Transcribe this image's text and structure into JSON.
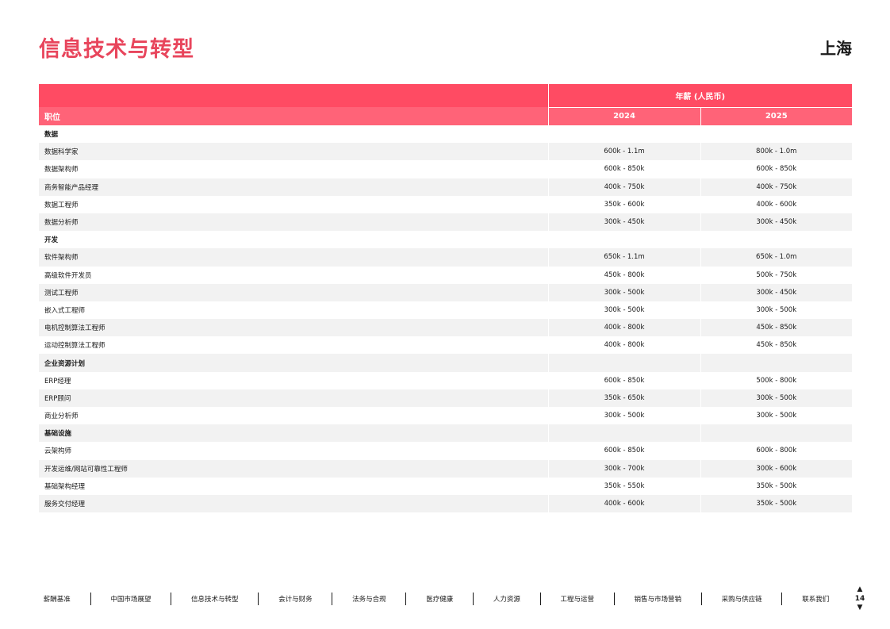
{
  "title": "信息技术与转型",
  "city": "上海",
  "table": {
    "group_header": "年薪 (人民币)",
    "position_header": "职位",
    "year1": "2024",
    "year2": "2025",
    "rows": [
      {
        "type": "cat",
        "role": "数据",
        "v2024": "",
        "v2025": ""
      },
      {
        "type": "item",
        "role": "数据科学家",
        "v2024": "600k - 1.1m",
        "v2025": "800k - 1.0m"
      },
      {
        "type": "item",
        "role": "数据架构师",
        "v2024": "600k - 850k",
        "v2025": "600k - 850k"
      },
      {
        "type": "item",
        "role": "商务智能产品经理",
        "v2024": "400k - 750k",
        "v2025": "400k - 750k"
      },
      {
        "type": "item",
        "role": "数据工程师",
        "v2024": "350k - 600k",
        "v2025": "400k - 600k"
      },
      {
        "type": "item",
        "role": "数据分析师",
        "v2024": "300k - 450k",
        "v2025": "300k - 450k"
      },
      {
        "type": "cat",
        "role": "开发",
        "v2024": "",
        "v2025": ""
      },
      {
        "type": "item",
        "role": "软件架构师",
        "v2024": "650k - 1.1m",
        "v2025": "650k - 1.0m"
      },
      {
        "type": "item",
        "role": "高级软件开发员",
        "v2024": "450k - 800k",
        "v2025": "500k - 750k"
      },
      {
        "type": "item",
        "role": "测试工程师",
        "v2024": "300k - 500k",
        "v2025": "300k - 450k"
      },
      {
        "type": "item",
        "role": "嵌入式工程师",
        "v2024": "300k - 500k",
        "v2025": "300k - 500k"
      },
      {
        "type": "item",
        "role": "电机控制算法工程师",
        "v2024": "400k - 800k",
        "v2025": "450k - 850k"
      },
      {
        "type": "item",
        "role": "运动控制算法工程师",
        "v2024": "400k - 800k",
        "v2025": "450k - 850k"
      },
      {
        "type": "cat",
        "role": "企业资源计划",
        "v2024": "",
        "v2025": ""
      },
      {
        "type": "item",
        "role": "ERP经理",
        "v2024": "600k - 850k",
        "v2025": "500k - 800k"
      },
      {
        "type": "item",
        "role": "ERP顾问",
        "v2024": "350k - 650k",
        "v2025": "300k - 500k"
      },
      {
        "type": "item",
        "role": "商业分析师",
        "v2024": "300k - 500k",
        "v2025": "300k - 500k"
      },
      {
        "type": "cat",
        "role": "基础设施",
        "v2024": "",
        "v2025": ""
      },
      {
        "type": "item",
        "role": "云架构师",
        "v2024": "600k - 850k",
        "v2025": "600k - 800k"
      },
      {
        "type": "item",
        "role": "开发运维/网站可靠性工程师",
        "v2024": "300k - 700k",
        "v2025": "300k - 600k"
      },
      {
        "type": "item",
        "role": "基础架构经理",
        "v2024": "350k - 550k",
        "v2025": "350k - 500k"
      },
      {
        "type": "item",
        "role": "服务交付经理",
        "v2024": "400k - 600k",
        "v2025": "350k - 500k"
      }
    ]
  },
  "footer_nav": [
    "薪酬基准",
    "中国市场展望",
    "信息技术与转型",
    "会计与财务",
    "法务与合规",
    "医疗健康",
    "人力资源",
    "工程与运营",
    "销售与市场营销",
    "采购与供应链",
    "联系我们"
  ],
  "page_number": "14",
  "colors": {
    "accent": "#e8455c",
    "header": "#ff4b63",
    "subheader": "#ff6378",
    "shade": "#f2f2f2"
  }
}
